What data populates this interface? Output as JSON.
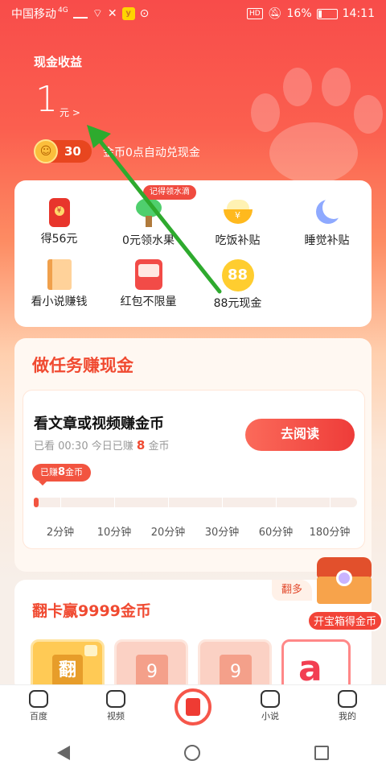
{
  "status_bar": {
    "carrier": "中国移动",
    "network": "4G",
    "battery": "16%",
    "time": "14:11",
    "hd": "HD"
  },
  "header": {
    "title": "现金收益",
    "cash_value": "1",
    "cash_unit": "元 >",
    "coins": "30",
    "coins_note": "金币0点自动兑现金"
  },
  "quick_menu": {
    "tip_badge": "记得领水滴",
    "items": [
      {
        "label": "得56元",
        "icon": "red-envelope-icon"
      },
      {
        "label": "0元领水果",
        "icon": "fruit-tree-icon"
      },
      {
        "label": "吃饭补贴",
        "icon": "rice-bowl-icon"
      },
      {
        "label": "睡觉补贴",
        "icon": "moon-icon"
      },
      {
        "label": "看小说赚钱",
        "icon": "book-icon"
      },
      {
        "label": "红包不限量",
        "icon": "red-packet-icon"
      },
      {
        "label": "88元现金",
        "icon": "coin-88-icon"
      }
    ]
  },
  "tasks": {
    "section_title": "做任务赚现金",
    "task_title": "看文章或视频赚金币",
    "watched_prefix": "已看 00:30 今日已赚",
    "earned_today": "8",
    "coin_unit": "金币",
    "read_button": "去阅读",
    "earned_badge_prefix": "已赚",
    "earned_badge_value": "8",
    "earned_badge_suffix": "金币",
    "progress": 0.01,
    "milestones": [
      "2分钟",
      "10分钟",
      "20分钟",
      "30分钟",
      "60分钟",
      "180分钟"
    ]
  },
  "flip": {
    "section_title": "翻卡赢9999金币",
    "tab_label": "翻多",
    "cards": [
      "翻",
      "9",
      "9",
      "a"
    ]
  },
  "treasure": {
    "button_label": "开宝箱得金币"
  },
  "bottom_nav": {
    "items": [
      {
        "label": "百度"
      },
      {
        "label": "视频"
      },
      {
        "label": ""
      },
      {
        "label": "小说"
      },
      {
        "label": "我的"
      }
    ]
  },
  "colors": {
    "primary_red": "#f04a31",
    "header_gradient_top": "#f84c4a",
    "annotation_arrow": "#2eaa2e"
  }
}
